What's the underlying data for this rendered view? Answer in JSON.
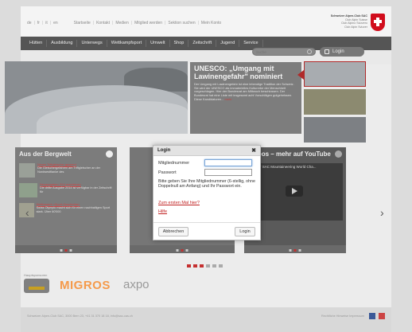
{
  "top_links": [
    "de",
    "fr",
    "it",
    "en",
    "Startseite",
    "Kontakt",
    "Medien",
    "Mitglied werden",
    "Sektion suchen",
    "Mein Konto"
  ],
  "brand": {
    "name": "Schweizer Alpen-Club SAC",
    "lines": [
      "Club Alpin Suisse",
      "Club Alpino Svizzero",
      "Club Alpin Svizzer"
    ]
  },
  "nav": [
    "Hütten",
    "Ausbildung",
    "Unterwegs",
    "Wettkampfsport",
    "Umwelt",
    "Shop",
    "Zeitschrift",
    "Jugend",
    "Service"
  ],
  "search": {
    "placeholder": "Suche"
  },
  "login_button": "Login",
  "hero": {
    "title": "UNESCO: „Umgang mit Lawinengefahr\" nominiert",
    "body": "Der Umgang mit Lawinengefahr ist eine lebendige Tradition der Schweiz. Sie wird der UNESCO als immaterielles Kulturerbe der Menschheit vorgeschlagen. Hier der Bundesrat am Mittwoch beschlossen. Der Bundesrat hat eine Liste mit insgesamt acht Vorschlägen gutgeheissen. Diese Kandidaturen...",
    "more": "mehr"
  },
  "card1": {
    "title": "Aus der Bergwelt",
    "news": [
      {
        "title": "Neues Triftgletscher gesperrt",
        "text": "Die Gletschergefahren am Triftgletscher an der Nordwestflanke des"
      },
      {
        "title": "Neuausgaben 2/14 erschienen",
        "text": "Die dritte Ausgabe 2014 ist verfügbar in der Zeitschrift für"
      },
      {
        "title": "Wettbewerb »Sport-Geschichte«",
        "text": "Swiss Olympic macht sich für einen nachhaltigen Sport stark. Über 60'000"
      }
    ]
  },
  "card3": {
    "title": "Videos – mehr auf YouTube",
    "video_title": "Teaser SAC Mountaineering World Cha..."
  },
  "sponsors_label": "Hauptsponsoren",
  "sponsors": [
    "MIGROS",
    "axpo"
  ],
  "footer": {
    "address": "Schweizer Alpen-Club SAC, 3000 Bern 23, +41 31 370 18 18, info@sac-cas.ch",
    "legal": "Rechtliche Hinweise  Impressum"
  },
  "modal": {
    "title": "Login",
    "member_label": "Mitgliednummer",
    "member_value": "",
    "password_label": "Passwort",
    "password_value": "",
    "help_text": "Bitte geben Sie Ihre Mitgliednummer (6-stellig, ohne Doppelnull am Anfang) und Ihr Passwort ein.",
    "first_time_link": "Zum ersten Mal hier?",
    "help_link": "Hilfe",
    "cancel": "Abbrechen",
    "submit": "Login"
  },
  "colors": {
    "accent": "#c53030",
    "nav_bg": "#555555",
    "overlay": "#7c7c7c"
  }
}
